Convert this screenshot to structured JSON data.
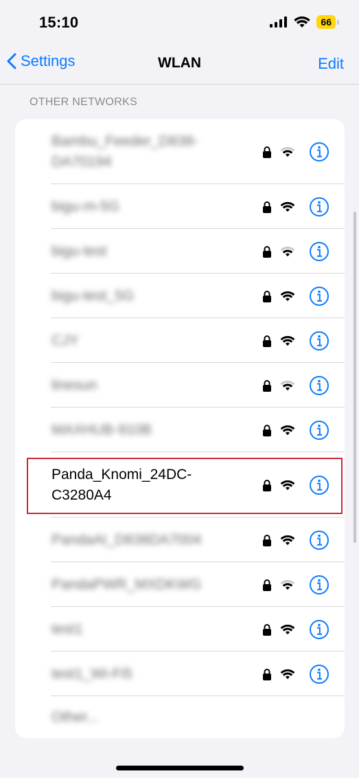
{
  "status": {
    "time": "15:10",
    "battery": "66"
  },
  "nav": {
    "back_label": "Settings",
    "title": "WLAN",
    "edit_label": "Edit"
  },
  "section": {
    "header": "OTHER NETWORKS"
  },
  "networks": [
    {
      "name": "Bambu_Feeder_D838-DA70194",
      "wifi_strength": 0.5
    },
    {
      "name": "bigu-m-5G",
      "wifi_strength": 1.0
    },
    {
      "name": "bigu-test",
      "wifi_strength": 0.5
    },
    {
      "name": "bigu-test_5G",
      "wifi_strength": 1.0
    },
    {
      "name": "CJY",
      "wifi_strength": 1.0
    },
    {
      "name": "linesun",
      "wifi_strength": 0.5
    },
    {
      "name": "MAXHUB-910B",
      "wifi_strength": 1.0
    },
    {
      "name": "Panda_Knomi_24DC-C3280A4",
      "wifi_strength": 1.0
    },
    {
      "name": "PandaAI_D838DA7004",
      "wifi_strength": 1.0
    },
    {
      "name": "PandaPWR_MXDKWG",
      "wifi_strength": 0.5
    },
    {
      "name": "test1",
      "wifi_strength": 1.0
    },
    {
      "name": "test1_Wi-Fi5",
      "wifi_strength": 1.0
    }
  ],
  "other_label": "Other...",
  "colors": {
    "accent": "#0a7aff",
    "highlight": "#c7283a",
    "battery": "#ffd60a"
  }
}
